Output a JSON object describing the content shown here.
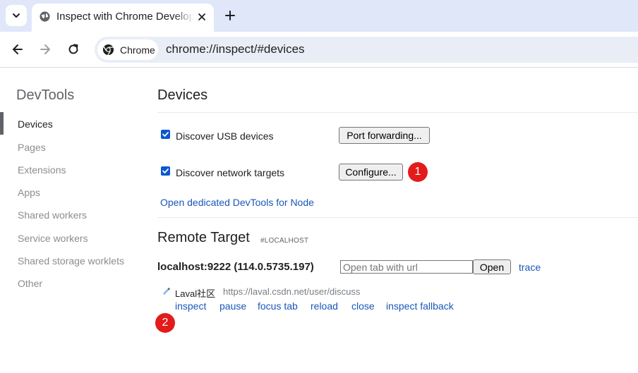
{
  "browser": {
    "tab": {
      "title": "Inspect with Chrome Developer Tools",
      "favicon": "globe-icon",
      "close": "close-icon"
    },
    "new_tab": "plus-icon",
    "tab_menu": "chevron-down-icon",
    "nav": {
      "back": "back-arrow-icon",
      "forward": "forward-arrow-icon",
      "reload": "reload-icon"
    },
    "omnibox": {
      "chip_label": "Chrome",
      "chip_icon": "chrome-logo-icon",
      "url": "chrome://inspect/#devices"
    }
  },
  "sidebar": {
    "title": "DevTools",
    "items": [
      {
        "label": "Devices",
        "active": true
      },
      {
        "label": "Pages"
      },
      {
        "label": "Extensions"
      },
      {
        "label": "Apps"
      },
      {
        "label": "Shared workers"
      },
      {
        "label": "Service workers"
      },
      {
        "label": "Shared storage worklets"
      },
      {
        "label": "Other"
      }
    ]
  },
  "devices": {
    "title": "Devices",
    "usb": {
      "label": "Discover USB devices",
      "checked": true,
      "button": "Port forwarding..."
    },
    "network": {
      "label": "Discover network targets",
      "checked": true,
      "button": "Configure..."
    },
    "node_link": "Open dedicated DevTools for Node"
  },
  "remote": {
    "title": "Remote Target",
    "subtitle": "#LOCALHOST",
    "host": "localhost:9222 (114.0.5735.197)",
    "url_placeholder": "Open tab with url",
    "open_button": "Open",
    "trace_link": "trace",
    "target": {
      "title": "Laval社区",
      "url": "https://laval.csdn.net/user/discuss",
      "icon": "page-icon",
      "actions": [
        "inspect",
        "pause",
        "focus tab",
        "reload",
        "close",
        "inspect fallback"
      ]
    }
  },
  "annotations": {
    "badge1": "1",
    "badge2": "2"
  },
  "colors": {
    "accent": "#0b57d0",
    "link": "#1a56b9",
    "badge": "#e31b1b",
    "tabstrip": "#dfe7f9"
  }
}
